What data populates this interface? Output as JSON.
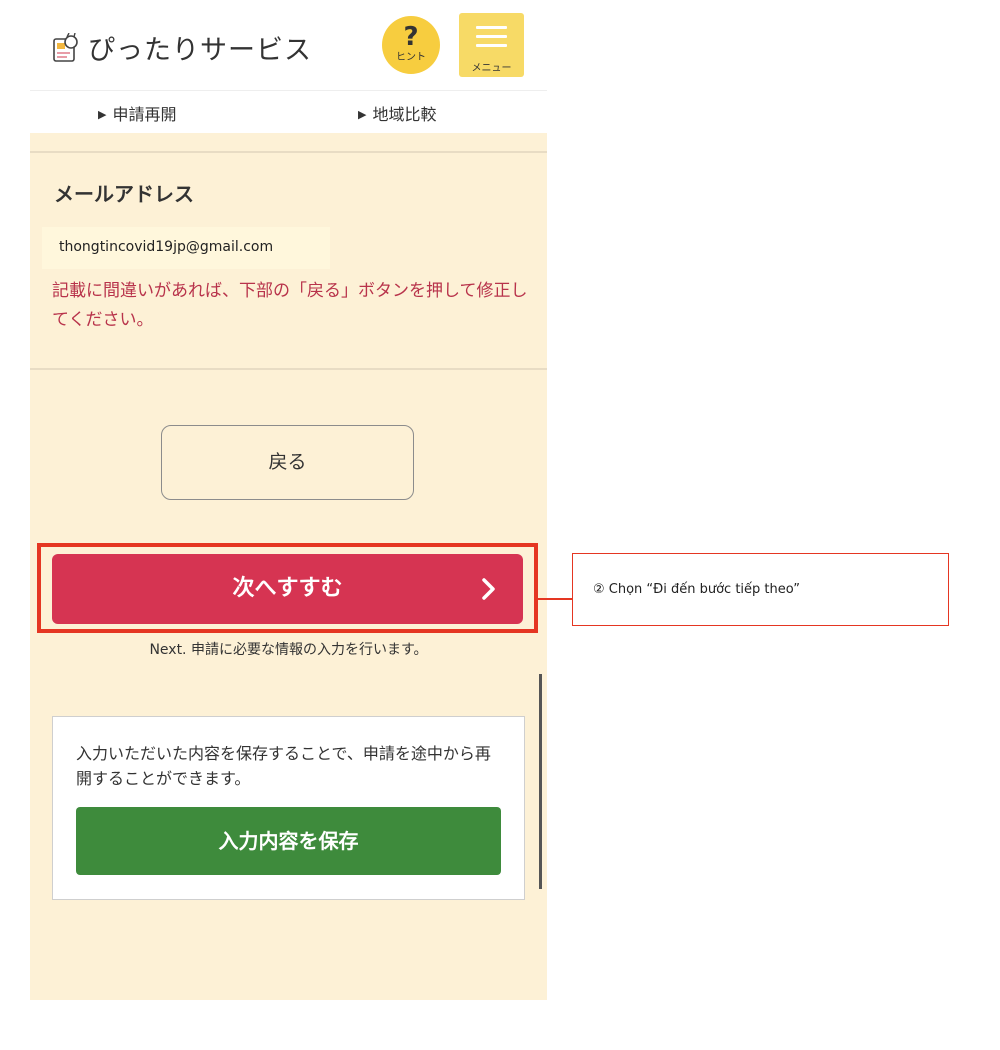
{
  "header": {
    "app_title": "ぴったりサービス",
    "hint_label": "ヒント",
    "hint_symbol": "?",
    "menu_label": "メニュー"
  },
  "subnav": {
    "items": [
      {
        "label": "申請再開"
      },
      {
        "label": "地域比較"
      }
    ]
  },
  "form": {
    "email_label": "メールアドレス",
    "email_value": "thongtincovid19jp@gmail.com",
    "notice": "記載に間違いがあれば、下部の「戻る」ボタンを押して修正してください。"
  },
  "actions": {
    "back_label": "戻る",
    "next_label": "次へすすむ",
    "next_caption": "Next. 申請に必要な情報の入力を行います。"
  },
  "save_section": {
    "description": "入力いただいた内容を保存することで、申請を途中から再開することができます。",
    "button_label": "入力内容を保存"
  },
  "annotation": {
    "callout_text": "② Chọn “Đi đến bước tiếp theo”"
  },
  "colors": {
    "page_bg": "#fdf1d6",
    "next_button": "#d63452",
    "save_button": "#3e8b3c",
    "hint_button": "#f7cd3f",
    "menu_button": "#f7da66",
    "notice_text": "#b8334b",
    "highlight": "#e53622"
  }
}
